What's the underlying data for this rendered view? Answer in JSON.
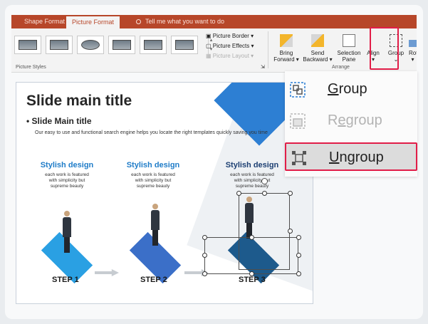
{
  "tabs": {
    "shape_format": "Shape Format",
    "picture_format": "Picture Format",
    "tell_me": "Tell me what you want to do"
  },
  "ribbon": {
    "picture_border": "Picture Border",
    "picture_effects": "Picture Effects",
    "picture_layout": "Picture Layout",
    "picture_styles_label": "Picture Styles",
    "arrange_label": "Arrange",
    "bring_forward_1": "Bring",
    "bring_forward_2": "Forward",
    "send_backward_1": "Send",
    "send_backward_2": "Backward",
    "selection_pane_1": "Selection",
    "selection_pane_2": "Pane",
    "align": "Align",
    "group": "Group",
    "rotate": "Rotate"
  },
  "slide": {
    "title": "Slide main title",
    "subtitle": "• Slide Main title",
    "description": "Our easy to use and functional search engine helps you locate the right templates quickly  saving you time",
    "features": [
      {
        "heading": "Stylish design",
        "body": "each work is featured\nwith simplicity but\nsupreme beauty"
      },
      {
        "heading": "Stylish design",
        "body": "each work is featured\nwith simplicity but\nsupreme beauty"
      },
      {
        "heading": "Stylish design",
        "body": "each work is featured\nwith simplicity but\nsupreme beauty"
      }
    ],
    "steps": [
      "STEP 1",
      "STEP 2",
      "STEP 3"
    ]
  },
  "menu": {
    "group": {
      "pre": "",
      "mnemonic": "G",
      "post": "roup"
    },
    "regroup": {
      "pre": "R",
      "mnemonic": "e",
      "post": "group"
    },
    "ungroup": {
      "pre": "",
      "mnemonic": "U",
      "post": "ngroup"
    }
  },
  "colors": {
    "ribbon_tab": "#b7472a",
    "accent_highlight": "#e11d48",
    "step1": "#2aa0e3",
    "step2": "#3b6fc8",
    "step3": "#1d5a8c"
  }
}
